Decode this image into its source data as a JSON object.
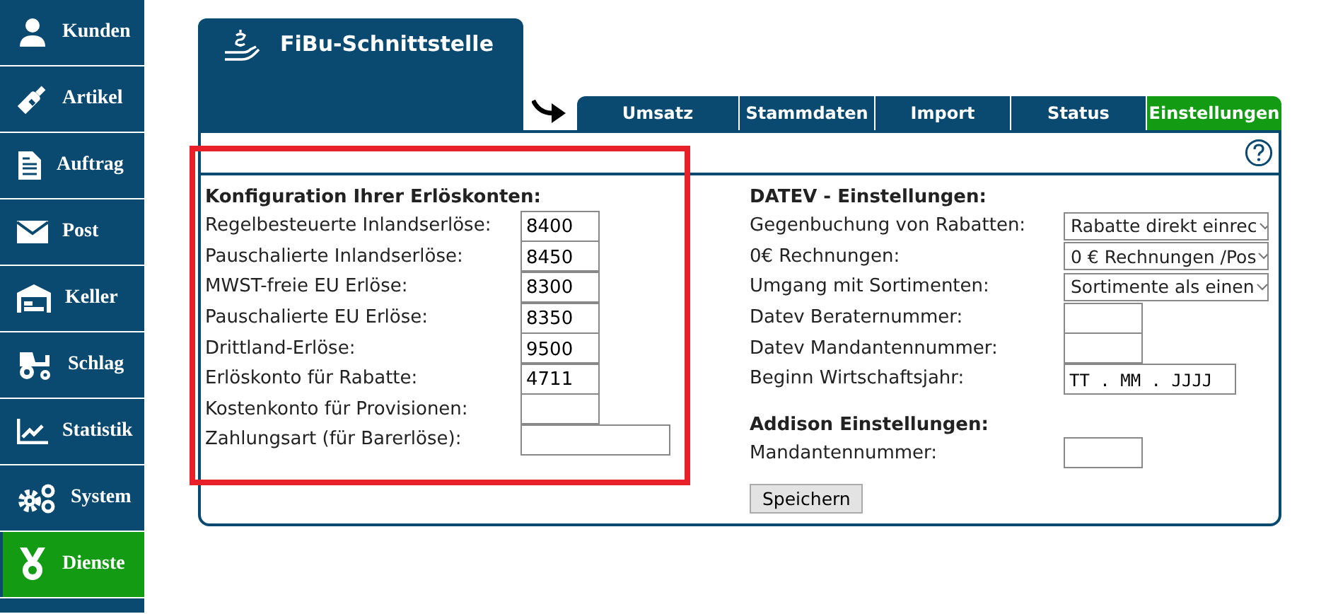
{
  "sidebar": {
    "items": [
      {
        "label": "Kunden",
        "kind": "person",
        "selected": false
      },
      {
        "label": "Artikel",
        "kind": "bottle",
        "selected": false
      },
      {
        "label": "Auftrag",
        "kind": "document",
        "selected": false
      },
      {
        "label": "Post",
        "kind": "envelope",
        "selected": false
      },
      {
        "label": "Keller",
        "kind": "warehouse",
        "selected": false
      },
      {
        "label": "Schlag",
        "kind": "tractor",
        "selected": false
      },
      {
        "label": "Statistik",
        "kind": "chart",
        "selected": false
      },
      {
        "label": "System",
        "kind": "gears",
        "selected": false
      },
      {
        "label": "Dienste",
        "kind": "medal",
        "selected": true
      }
    ]
  },
  "panel": {
    "title": "FiBu-Schnittstelle",
    "tabs": [
      {
        "label": "Umsatz",
        "selected": false
      },
      {
        "label": "Stammdaten",
        "selected": false
      },
      {
        "label": "Import",
        "selected": false
      },
      {
        "label": "Status",
        "selected": false
      },
      {
        "label": "Einstellungen",
        "selected": true
      }
    ]
  },
  "erloeskonten": {
    "heading": "Konfiguration Ihrer Erlöskonten:",
    "highlighted": true,
    "fields": [
      {
        "label": "Regelbesteuerte Inlandserlöse:",
        "value": "8400",
        "kind": "short"
      },
      {
        "label": "Pauschalierte Inlandserlöse:",
        "value": "8450",
        "kind": "short"
      },
      {
        "label": "MWST-freie EU Erlöse:",
        "value": "8300",
        "kind": "short"
      },
      {
        "label": "Pauschalierte EU Erlöse:",
        "value": "8350",
        "kind": "short"
      },
      {
        "label": "Drittland-Erlöse:",
        "value": "9500",
        "kind": "short"
      },
      {
        "label": "Erlöskonto für Rabatte:",
        "value": "4711",
        "kind": "short"
      },
      {
        "label": "Kostenkonto für Provisionen:",
        "kind": "short"
      },
      {
        "label": "Zahlungsart (für Barerlöse):",
        "kind": "wide"
      }
    ]
  },
  "datev": {
    "heading": "DATEV - Einstellungen:",
    "fields": [
      {
        "label": "Gegenbuchung von Rabatten:",
        "value": "Rabatte direkt einrec",
        "kind": "select"
      },
      {
        "label": "0€ Rechnungen:",
        "value": "0 € Rechnungen /Pos",
        "kind": "select"
      },
      {
        "label": "Umgang mit Sortimenten:",
        "value": "Sortimente als einen",
        "kind": "select"
      },
      {
        "label": "Datev Beraternummer:",
        "kind": "short"
      },
      {
        "label": "Datev Mandantennummer:",
        "kind": "short"
      },
      {
        "label": "Beginn Wirtschaftsjahr:",
        "placeholder": "TT . MM . JJJJ",
        "kind": "date"
      }
    ]
  },
  "addison": {
    "heading": "Addison Einstellungen:",
    "fields": [
      {
        "label": "Mandantennummer:",
        "kind": "short"
      }
    ]
  },
  "save_button": "Speichern"
}
